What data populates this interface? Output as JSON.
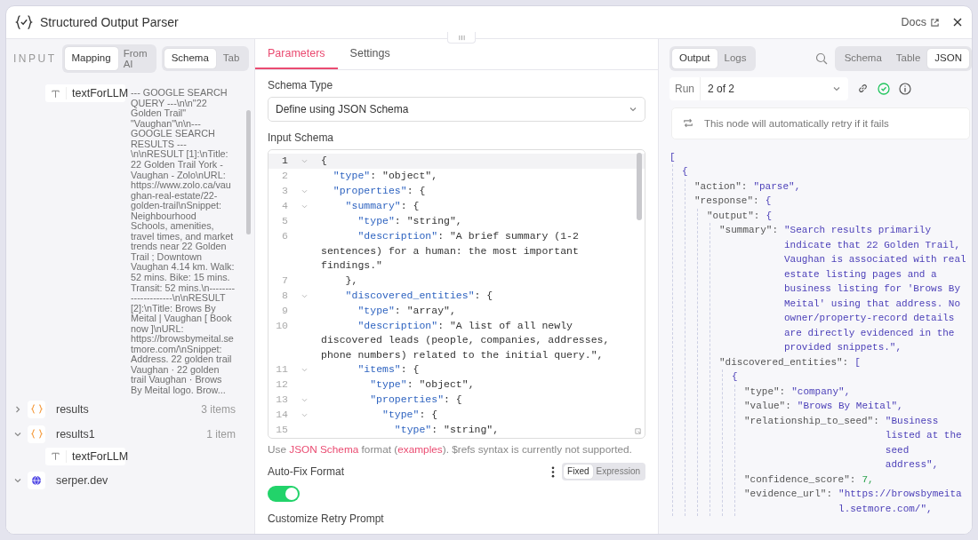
{
  "window": {
    "title": "Structured Output Parser",
    "docs_link": "Docs"
  },
  "input_panel": {
    "label": "INPUT",
    "mode_tabs": [
      {
        "label": "Mapping",
        "selected": true
      },
      {
        "label": "From AI",
        "selected": false
      }
    ],
    "view_tabs": [
      {
        "label": "Schema",
        "selected": true
      },
      {
        "label": "Tab",
        "selected": false
      }
    ],
    "tree": [
      {
        "kind": "group",
        "children": [
          {
            "kind": "field",
            "name": "textForLLM",
            "value": "--- GOOGLE SEARCH QUERY ---\\n\\n\"22 Golden Trail\" \"Vaughan\"\\n\\n--- GOOGLE SEARCH RESULTS ---\\n\\nRESULT [1]:\\nTitle: 22 Golden Trail York - Vaughan - Zolo\\nURL: https://www.zolo.ca/vaughan-real-estate/22-golden-trail\\nSnippet: Neighbourhood Schools, amenities, travel times, and market trends near 22 Golden Trail ; Downtown Vaughan 4.14 km. Walk: 52 mins. Bike: 15 mins. Transit: 52 mins.\\n---------------------\\n\\nRESULT [2]:\\nTitle: Brows By Meital | Vaughan [ Book now ]\\nURL: https://browsbymeital.setmore.com/\\nSnippet: Address.  22 golden trail Vaughan · 22 golden trail Vaughan · Brows By Meital logo. Brow..."
          }
        ]
      },
      {
        "kind": "object",
        "name": "results",
        "count": "3 items",
        "expanded": false
      },
      {
        "kind": "object",
        "name": "results1",
        "count": "1 item",
        "expanded": true,
        "children": [
          {
            "kind": "field",
            "name": "textForLLM"
          }
        ]
      },
      {
        "kind": "node",
        "name": "serper.dev",
        "expanded": true
      }
    ]
  },
  "parameters_panel": {
    "tabs": [
      {
        "label": "Parameters",
        "selected": true
      },
      {
        "label": "Settings",
        "selected": false
      }
    ],
    "schema_type": {
      "label": "Schema Type",
      "value": "Define using JSON Schema"
    },
    "input_schema": {
      "label": "Input Schema",
      "lines": [
        {
          "number": "1",
          "fold": true,
          "active": true,
          "parts": [
            {
              "kind": "text",
              "text": "{"
            }
          ]
        },
        {
          "number": "2",
          "fold": false,
          "active": false,
          "parts": [
            {
              "kind": "key",
              "text": "  \"type\""
            },
            {
              "kind": "text",
              "text": ": \"object\","
            }
          ]
        },
        {
          "number": "3",
          "fold": true,
          "active": false,
          "parts": [
            {
              "kind": "key",
              "text": "  \"properties\""
            },
            {
              "kind": "text",
              "text": ": {"
            }
          ]
        },
        {
          "number": "4",
          "fold": true,
          "active": false,
          "parts": [
            {
              "kind": "key",
              "text": "    \"summary\""
            },
            {
              "kind": "text",
              "text": ": {"
            }
          ]
        },
        {
          "number": "5",
          "fold": false,
          "active": false,
          "parts": [
            {
              "kind": "key",
              "text": "      \"type\""
            },
            {
              "kind": "text",
              "text": ": \"string\","
            }
          ]
        },
        {
          "number": "6",
          "fold": false,
          "active": false,
          "parts": [
            {
              "kind": "key",
              "text": "      \"description\""
            },
            {
              "kind": "text",
              "text": ": \"A brief summary (1-2 sentences) for a human: the most important findings.\""
            }
          ]
        },
        {
          "number": "7",
          "fold": false,
          "active": false,
          "parts": [
            {
              "kind": "text",
              "text": "    },"
            }
          ]
        },
        {
          "number": "8",
          "fold": true,
          "active": false,
          "parts": [
            {
              "kind": "key",
              "text": "    \"discovered_entities\""
            },
            {
              "kind": "text",
              "text": ": {"
            }
          ]
        },
        {
          "number": "9",
          "fold": false,
          "active": false,
          "parts": [
            {
              "kind": "key",
              "text": "      \"type\""
            },
            {
              "kind": "text",
              "text": ": \"array\","
            }
          ]
        },
        {
          "number": "10",
          "fold": false,
          "active": false,
          "parts": [
            {
              "kind": "key",
              "text": "      \"description\""
            },
            {
              "kind": "text",
              "text": ": \"A list of all newly discovered leads (people, companies, addresses, phone numbers) related to the initial query.\","
            }
          ]
        },
        {
          "number": "11",
          "fold": true,
          "active": false,
          "parts": [
            {
              "kind": "key",
              "text": "      \"items\""
            },
            {
              "kind": "text",
              "text": ": {"
            }
          ]
        },
        {
          "number": "12",
          "fold": false,
          "active": false,
          "parts": [
            {
              "kind": "key",
              "text": "        \"type\""
            },
            {
              "kind": "text",
              "text": ": \"object\","
            }
          ]
        },
        {
          "number": "13",
          "fold": true,
          "active": false,
          "parts": [
            {
              "kind": "key",
              "text": "        \"properties\""
            },
            {
              "kind": "text",
              "text": ": {"
            }
          ]
        },
        {
          "number": "14",
          "fold": true,
          "active": false,
          "parts": [
            {
              "kind": "key",
              "text": "          \"type\""
            },
            {
              "kind": "text",
              "text": ": {"
            }
          ]
        },
        {
          "number": "15",
          "fold": false,
          "active": false,
          "parts": [
            {
              "kind": "key",
              "text": "            \"type\""
            },
            {
              "kind": "text",
              "text": ": \"string\","
            }
          ]
        }
      ]
    },
    "help_text": [
      {
        "kind": "text",
        "text": "Use "
      },
      {
        "kind": "link",
        "text": "JSON Schema"
      },
      {
        "kind": "text",
        "text": " format ("
      },
      {
        "kind": "link",
        "text": "examples"
      },
      {
        "kind": "text",
        "text": "). $refs syntax is currently not supported."
      }
    ],
    "auto_fix": {
      "label": "Auto-Fix Format",
      "modes": [
        {
          "label": "Fixed",
          "selected": true
        },
        {
          "label": "Expression",
          "selected": false
        }
      ],
      "on": true
    },
    "next_label": "Customize Retry Prompt"
  },
  "output_panel": {
    "view_tabs": [
      {
        "label": "Output",
        "selected": true
      },
      {
        "label": "Logs",
        "selected": false
      }
    ],
    "format_tabs": [
      {
        "label": "Schema",
        "selected": false
      },
      {
        "label": "Table",
        "selected": false
      },
      {
        "label": "JSON",
        "selected": true
      }
    ],
    "run": {
      "label": "Run",
      "value": "2 of 2"
    },
    "notice": "This node will automatically retry if it fails",
    "json": [
      {
        "open": "[",
        "children": [
          {
            "open": "{",
            "children": [
              {
                "key": "\"action\":",
                "value": "\"parse\",",
                "kind": "string"
              },
              {
                "key": "\"response\":",
                "open": "{",
                "children": [
                  {
                    "key": "\"output\":",
                    "open": "{",
                    "children": [
                      {
                        "key": "\"summary\":",
                        "value": "\"Search results primarily indicate that 22 Golden Trail, Vaughan is associated with real estate listing pages and a business listing for 'Brows By Meital' using that address. No owner/property-record details are directly evidenced in the provided snippets.\",",
                        "kind": "string"
                      },
                      {
                        "key": "\"discovered_entities\":",
                        "open": "[",
                        "children": [
                          {
                            "open": "{",
                            "children": [
                              {
                                "key": "\"type\":",
                                "value": "\"company\",",
                                "kind": "string"
                              },
                              {
                                "key": "\"value\":",
                                "value": "\"Brows By Meital\",",
                                "kind": "string"
                              },
                              {
                                "key": "\"relationship_to_seed\":",
                                "value": "\"Business listed at the seed address\",",
                                "kind": "string"
                              },
                              {
                                "key": "\"confidence_score\":",
                                "value": "7,",
                                "kind": "number"
                              },
                              {
                                "key": "\"evidence_url\":",
                                "value": "\"https://browsbymeital.setmore.com/\",",
                                "kind": "string"
                              }
                            ]
                          }
                        ]
                      }
                    ]
                  }
                ]
              }
            ]
          }
        ]
      }
    ]
  }
}
